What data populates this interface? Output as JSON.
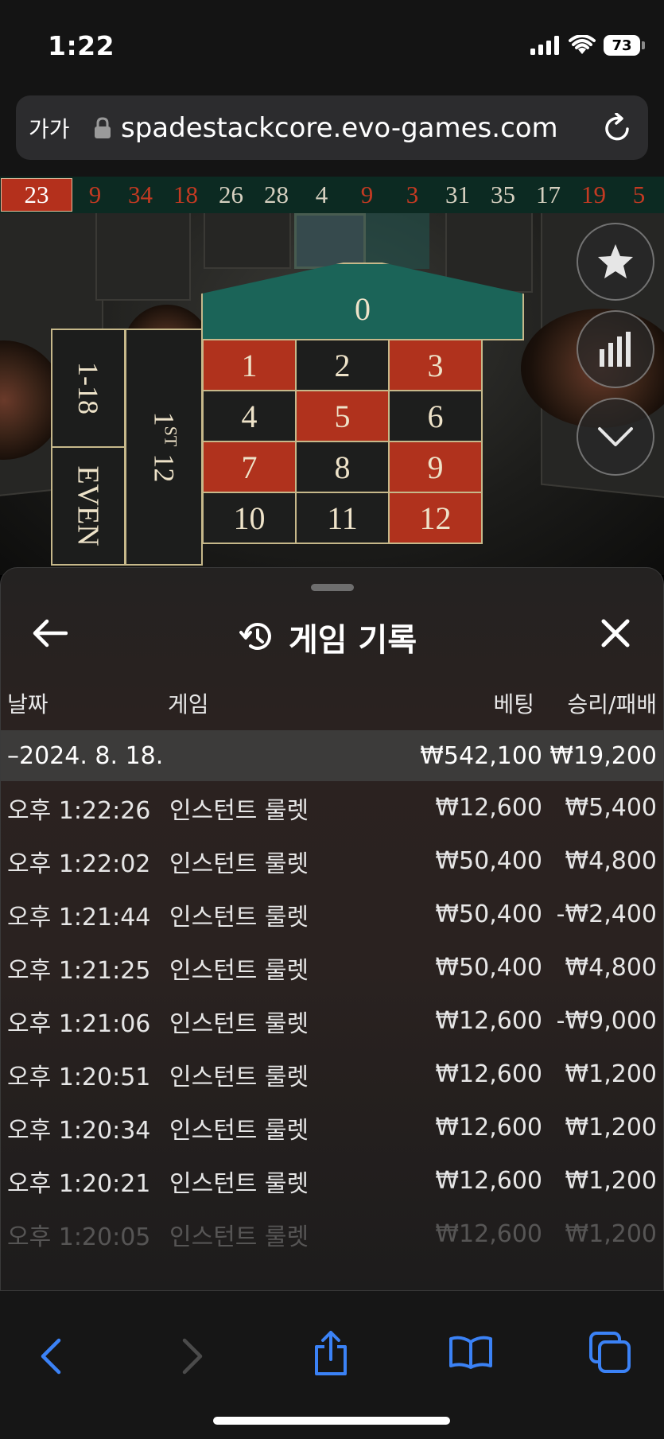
{
  "status_bar": {
    "time": "1:22",
    "battery": "73"
  },
  "browser": {
    "aa_label": "가가",
    "url": "spadestackcore.evo-games.com"
  },
  "history_strip": [
    {
      "n": "23",
      "color": "red"
    },
    {
      "n": "9",
      "color": "red"
    },
    {
      "n": "34",
      "color": "red"
    },
    {
      "n": "18",
      "color": "red"
    },
    {
      "n": "26",
      "color": "black"
    },
    {
      "n": "28",
      "color": "black"
    },
    {
      "n": "4",
      "color": "black"
    },
    {
      "n": "9",
      "color": "red"
    },
    {
      "n": "3",
      "color": "red"
    },
    {
      "n": "31",
      "color": "black"
    },
    {
      "n": "35",
      "color": "black"
    },
    {
      "n": "17",
      "color": "black"
    },
    {
      "n": "19",
      "color": "red"
    },
    {
      "n": "5",
      "color": "red"
    }
  ],
  "board": {
    "zero": "0",
    "low": "1-18",
    "even": "EVEN",
    "dozen_main": "1",
    "dozen_sup": "ST",
    "dozen_tail": "12",
    "numbers": [
      {
        "n": "1",
        "color": "red"
      },
      {
        "n": "2",
        "color": "black"
      },
      {
        "n": "3",
        "color": "red"
      },
      {
        "n": "4",
        "color": "black"
      },
      {
        "n": "5",
        "color": "red"
      },
      {
        "n": "6",
        "color": "black"
      },
      {
        "n": "7",
        "color": "red"
      },
      {
        "n": "8",
        "color": "black"
      },
      {
        "n": "9",
        "color": "red"
      },
      {
        "n": "10",
        "color": "black"
      },
      {
        "n": "11",
        "color": "black"
      },
      {
        "n": "12",
        "color": "red"
      }
    ]
  },
  "sheet": {
    "title": "게임 기록",
    "columns": {
      "date": "날짜",
      "game": "게임",
      "bet": "베팅",
      "win": "승리/패배"
    },
    "date_group": {
      "date": "–2024. 8. 18.",
      "bet": "₩542,100",
      "win": "₩19,200"
    },
    "rows": [
      {
        "time": "오후 1:22:26",
        "game": "인스턴트 룰렛",
        "bet": "₩12,600",
        "win": "₩5,400"
      },
      {
        "time": "오후 1:22:02",
        "game": "인스턴트 룰렛",
        "bet": "₩50,400",
        "win": "₩4,800"
      },
      {
        "time": "오후 1:21:44",
        "game": "인스턴트 룰렛",
        "bet": "₩50,400",
        "win": "-₩2,400"
      },
      {
        "time": "오후 1:21:25",
        "game": "인스턴트 룰렛",
        "bet": "₩50,400",
        "win": "₩4,800"
      },
      {
        "time": "오후 1:21:06",
        "game": "인스턴트 룰렛",
        "bet": "₩12,600",
        "win": "-₩9,000"
      },
      {
        "time": "오후 1:20:51",
        "game": "인스턴트 룰렛",
        "bet": "₩12,600",
        "win": "₩1,200"
      },
      {
        "time": "오후 1:20:34",
        "game": "인스턴트 룰렛",
        "bet": "₩12,600",
        "win": "₩1,200"
      },
      {
        "time": "오후 1:20:21",
        "game": "인스턴트 룰렛",
        "bet": "₩12,600",
        "win": "₩1,200"
      },
      {
        "time": "오후 1:20:05",
        "game": "인스턴트 룰렛",
        "bet": "₩12,600",
        "win": "₩1,200"
      }
    ]
  },
  "colors": {
    "red": "#b0321d",
    "black": "#1d1e1d",
    "felt": "#1b6458",
    "gold": "#c6b88a",
    "link_blue": "#3b82f6"
  }
}
